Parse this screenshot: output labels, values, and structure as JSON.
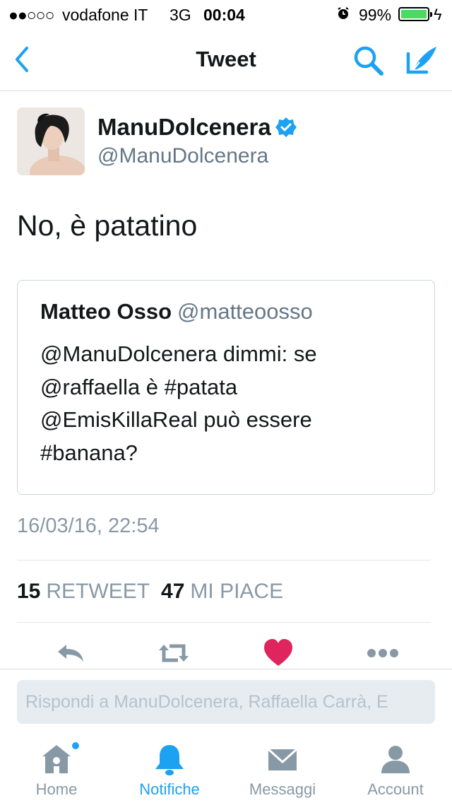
{
  "status_bar": {
    "signal": "●●○○○",
    "carrier": "vodafone IT",
    "network": "3G",
    "time": "00:04",
    "battery": "99%",
    "battery_level": 0.99
  },
  "nav": {
    "title": "Tweet",
    "back_icon": "chevron-left-icon",
    "search_icon": "search-icon",
    "compose_icon": "compose-tweet-icon"
  },
  "tweet": {
    "name": "ManuDolcenera",
    "handle": "@ManuDolcenera",
    "verified": true,
    "text": "No, è patatino",
    "timestamp": "16/03/16, 22:54",
    "retweets": "15",
    "retweets_label": "RETWEET",
    "likes": "47",
    "likes_label": "MI PIACE"
  },
  "quoted": {
    "name": "Matteo Osso",
    "handle": "@matteoosso",
    "lines": [
      "@ManuDolcenera dimmi: se",
      "@raffaella è #patata",
      "@EmisKillaReal può essere",
      "#banana?"
    ]
  },
  "actions": {
    "reply_icon": "reply-icon",
    "retweet_icon": "retweet-icon",
    "like_icon": "heart-icon",
    "more_icon": "more-icon"
  },
  "reply_box": {
    "placeholder": "Rispondi a ManuDolcenera, Raffaella Carrà, E"
  },
  "tabs": [
    {
      "label": "Home",
      "icon": "home-icon"
    },
    {
      "label": "Notifiche",
      "icon": "bell-icon"
    },
    {
      "label": "Messaggi",
      "icon": "envelope-icon"
    },
    {
      "label": "Account",
      "icon": "person-icon"
    }
  ],
  "colors": {
    "accent": "#1da1f2",
    "like": "#e0245e",
    "secondary_text": "#657786"
  }
}
